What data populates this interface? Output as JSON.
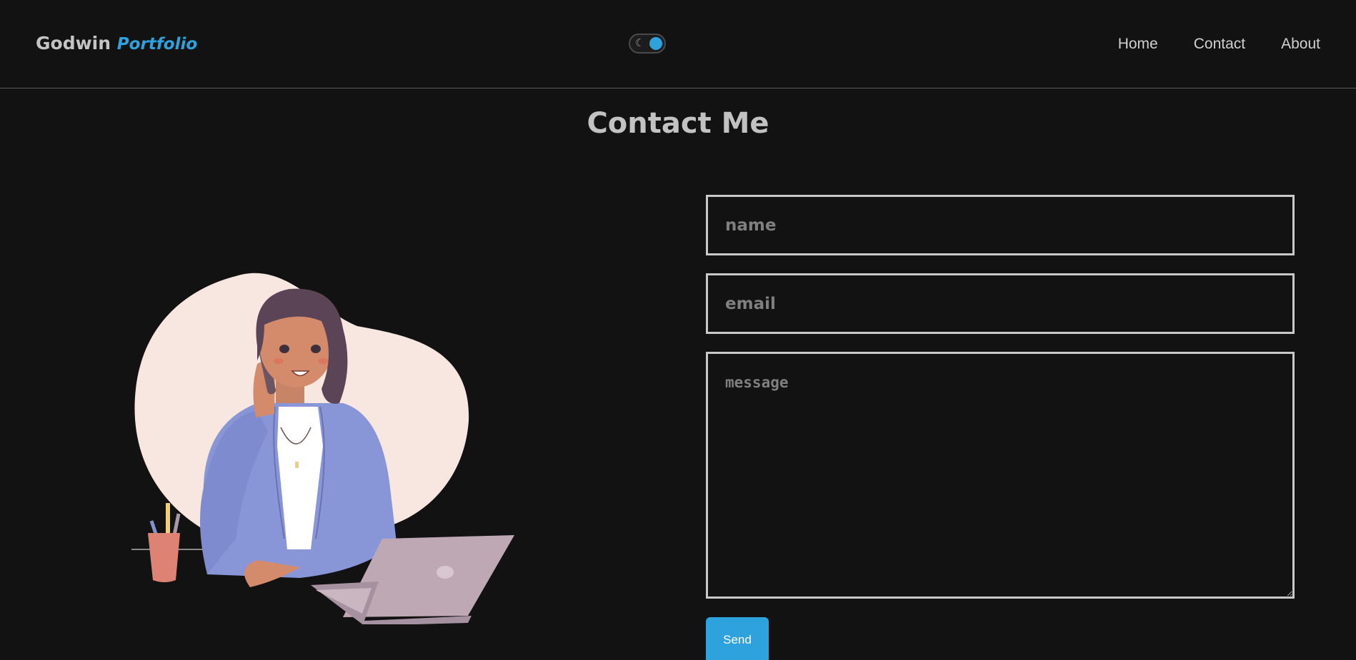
{
  "header": {
    "logo_main": "Godwin",
    "logo_accent": "Portfolio",
    "theme_toggle_icon": "moon-icon",
    "nav": [
      {
        "label": "Home"
      },
      {
        "label": "Contact"
      },
      {
        "label": "About"
      }
    ]
  },
  "main": {
    "title": "Contact Me",
    "form": {
      "name_placeholder": "name",
      "email_placeholder": "email",
      "message_placeholder": "message",
      "send_label": "Send"
    }
  },
  "colors": {
    "background": "#121212",
    "accent": "#2ea2dd",
    "text": "#c9c9c9"
  }
}
